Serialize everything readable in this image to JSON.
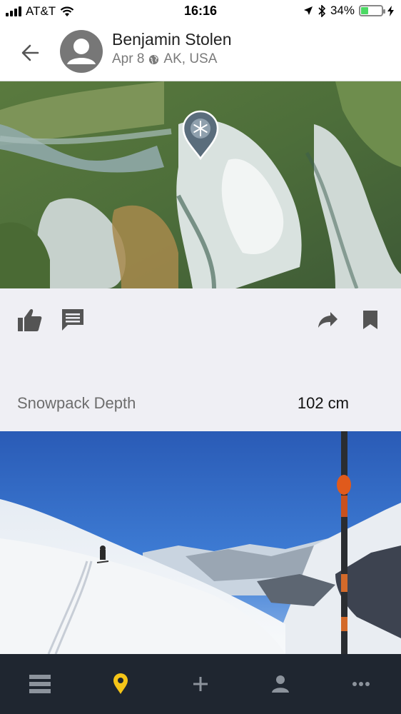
{
  "status_bar": {
    "carrier": "AT&T",
    "time": "16:16",
    "battery": "34%",
    "battery_level": 0.34,
    "icons": [
      "signal-icon",
      "wifi-icon",
      "location-arrow-icon",
      "bluetooth-icon",
      "battery-icon",
      "charging-icon"
    ]
  },
  "header": {
    "user_name": "Benjamin Stolen",
    "date": "Apr 8",
    "location": "AK, USA",
    "icons": [
      "back-arrow-icon",
      "avatar-icon",
      "globe-icon"
    ]
  },
  "map": {
    "marker_icon": "snowflake-pin-icon"
  },
  "actions": {
    "icons": [
      "thumbs-up-icon",
      "comment-icon",
      "share-icon",
      "bookmark-icon"
    ]
  },
  "observation": {
    "label": "Snowpack Depth",
    "value": "102 cm"
  },
  "tabbar": {
    "icons": [
      "list-icon",
      "map-pin-icon",
      "plus-icon",
      "person-icon",
      "more-icon"
    ],
    "active_color": "#f5c518",
    "inactive_color": "#8c939c",
    "background": "#1f2630"
  }
}
